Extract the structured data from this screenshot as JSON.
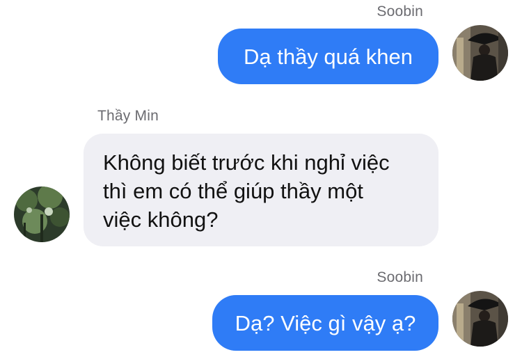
{
  "messages": [
    {
      "sender": "Soobin",
      "text": "Dạ thầy quá khen",
      "direction": "outgoing"
    },
    {
      "sender": "Thầy Min",
      "lines": [
        "Không biết trước khi nghỉ việc",
        "thì em có thể giúp thầy một",
        "việc không?"
      ],
      "direction": "incoming"
    },
    {
      "sender": "Soobin",
      "text": "Dạ? Việc gì vậy ạ?",
      "direction": "outgoing"
    }
  ],
  "colors": {
    "outgoing_bubble": "#2f7cf6",
    "incoming_bubble": "#efeff4",
    "sender_label": "#6b6b70"
  },
  "icons": {
    "outgoing_avatar": "avatar-person-with-umbrella",
    "incoming_avatar": "avatar-trees"
  }
}
